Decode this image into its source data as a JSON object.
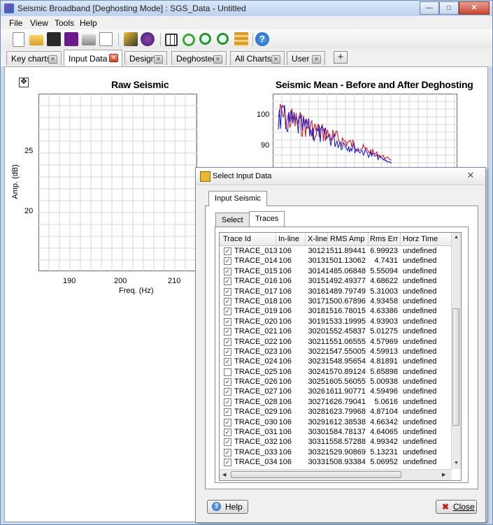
{
  "window": {
    "title": "Seismic Broadband [Deghosting Mode] : SGS_Data - Untitled"
  },
  "menu": [
    "File",
    "View",
    "Tools",
    "Help"
  ],
  "tabs": [
    {
      "label": "Key charts",
      "active": false
    },
    {
      "label": "Input Data",
      "active": true
    },
    {
      "label": "Design",
      "active": false
    },
    {
      "label": "Deghosted",
      "active": false
    },
    {
      "label": "All Charts",
      "active": false
    },
    {
      "label": "User",
      "active": false
    }
  ],
  "add_tab_label": "+",
  "raw_chart": {
    "title": "Raw Seismic",
    "xlabel": "Freq. (Hz)",
    "ylabel": "Amp. (dB)",
    "xticks": [
      "190",
      "200",
      "210"
    ],
    "yticks": [
      "25",
      "20"
    ]
  },
  "mean_chart": {
    "title": "Seismic Mean - Before and After Deghosting",
    "yticks": [
      "100",
      "90"
    ],
    "colors": {
      "before": "#d01010",
      "after": "#1010d0"
    }
  },
  "chart_data": [
    {
      "type": "line",
      "title": "Raw Seismic",
      "xlabel": "Freq. (Hz)",
      "ylabel": "Amp. (dB)",
      "xlim": [
        185,
        215
      ],
      "ylim": [
        15,
        29
      ],
      "series": []
    },
    {
      "type": "line",
      "title": "Seismic Mean - Before and After Deghosting",
      "ylim": [
        78,
        107
      ],
      "series": []
    }
  ],
  "dialog": {
    "title": "Select Input Data",
    "outer_tab": "Input Seismic",
    "inner_tabs": [
      "Select",
      "Traces"
    ],
    "columns": [
      "Trace Id",
      "In-line",
      "X-line",
      "RMS Amp",
      "Rms Err",
      "Horz Time"
    ],
    "rows": [
      {
        "checked": true,
        "id": "TRACE_013",
        "inline": "106",
        "xline": "3012",
        "rms": "1511.89441",
        "err": "6.99923",
        "horz": "undefined"
      },
      {
        "checked": true,
        "id": "TRACE_014",
        "inline": "106",
        "xline": "3013",
        "rms": "1501.13062",
        "err": "4.7431",
        "horz": "undefined"
      },
      {
        "checked": true,
        "id": "TRACE_015",
        "inline": "106",
        "xline": "3014",
        "rms": "1485.06848",
        "err": "5.55094",
        "horz": "undefined"
      },
      {
        "checked": true,
        "id": "TRACE_016",
        "inline": "106",
        "xline": "3015",
        "rms": "1492.49377",
        "err": "4.68622",
        "horz": "undefined"
      },
      {
        "checked": true,
        "id": "TRACE_017",
        "inline": "106",
        "xline": "3016",
        "rms": "1489.79749",
        "err": "5.31003",
        "horz": "undefined"
      },
      {
        "checked": true,
        "id": "TRACE_018",
        "inline": "106",
        "xline": "3017",
        "rms": "1500.67896",
        "err": "4.93458",
        "horz": "undefined"
      },
      {
        "checked": true,
        "id": "TRACE_019",
        "inline": "106",
        "xline": "3018",
        "rms": "1516.78015",
        "err": "4.63386",
        "horz": "undefined"
      },
      {
        "checked": true,
        "id": "TRACE_020",
        "inline": "106",
        "xline": "3019",
        "rms": "1533.19995",
        "err": "4.93903",
        "horz": "undefined"
      },
      {
        "checked": true,
        "id": "TRACE_021",
        "inline": "106",
        "xline": "3020",
        "rms": "1552.45837",
        "err": "5.01275",
        "horz": "undefined"
      },
      {
        "checked": true,
        "id": "TRACE_022",
        "inline": "106",
        "xline": "3021",
        "rms": "1551.06555",
        "err": "4.57969",
        "horz": "undefined"
      },
      {
        "checked": true,
        "id": "TRACE_023",
        "inline": "106",
        "xline": "3022",
        "rms": "1547.55005",
        "err": "4.59913",
        "horz": "undefined"
      },
      {
        "checked": true,
        "id": "TRACE_024",
        "inline": "106",
        "xline": "3023",
        "rms": "1548.95654",
        "err": "4.81891",
        "horz": "undefined"
      },
      {
        "checked": false,
        "id": "TRACE_025",
        "inline": "106",
        "xline": "3024",
        "rms": "1570.89124",
        "err": "5.65898",
        "horz": "undefined"
      },
      {
        "checked": true,
        "id": "TRACE_026",
        "inline": "106",
        "xline": "3025",
        "rms": "1605.56055",
        "err": "5.00938",
        "horz": "undefined"
      },
      {
        "checked": true,
        "id": "TRACE_027",
        "inline": "106",
        "xline": "3026",
        "rms": "1611.90771",
        "err": "4.59496",
        "horz": "undefined"
      },
      {
        "checked": true,
        "id": "TRACE_028",
        "inline": "106",
        "xline": "3027",
        "rms": "1626.79041",
        "err": "5.0616",
        "horz": "undefined"
      },
      {
        "checked": true,
        "id": "TRACE_029",
        "inline": "106",
        "xline": "3028",
        "rms": "1623.79968",
        "err": "4.87104",
        "horz": "undefined"
      },
      {
        "checked": true,
        "id": "TRACE_030",
        "inline": "106",
        "xline": "3029",
        "rms": "1612.38538",
        "err": "4.66342",
        "horz": "undefined"
      },
      {
        "checked": true,
        "id": "TRACE_031",
        "inline": "106",
        "xline": "3030",
        "rms": "1584.78137",
        "err": "4.64065",
        "horz": "undefined"
      },
      {
        "checked": true,
        "id": "TRACE_032",
        "inline": "106",
        "xline": "3031",
        "rms": "1558.57288",
        "err": "4.99342",
        "horz": "undefined"
      },
      {
        "checked": true,
        "id": "TRACE_033",
        "inline": "106",
        "xline": "3032",
        "rms": "1529.90869",
        "err": "5.13231",
        "horz": "undefined"
      },
      {
        "checked": true,
        "id": "TRACE_034",
        "inline": "106",
        "xline": "3033",
        "rms": "1508.93384",
        "err": "5.06952",
        "horz": "undefined"
      }
    ],
    "help_label": "Help",
    "close_label": "Close"
  },
  "icons": {
    "toolbar": [
      "new-file-icon",
      "open-folder-icon",
      "save-icon",
      "save-as-icon",
      "print-icon",
      "properties-icon",
      "chart-edit-icon",
      "settings-icon",
      "grid-icon",
      "refresh-icon",
      "zoom-in-icon",
      "zoom-out-icon",
      "layers-icon",
      "help-icon"
    ]
  },
  "colors": {
    "accent": "#3a78c8",
    "window_frame": "#c8d9ee"
  }
}
